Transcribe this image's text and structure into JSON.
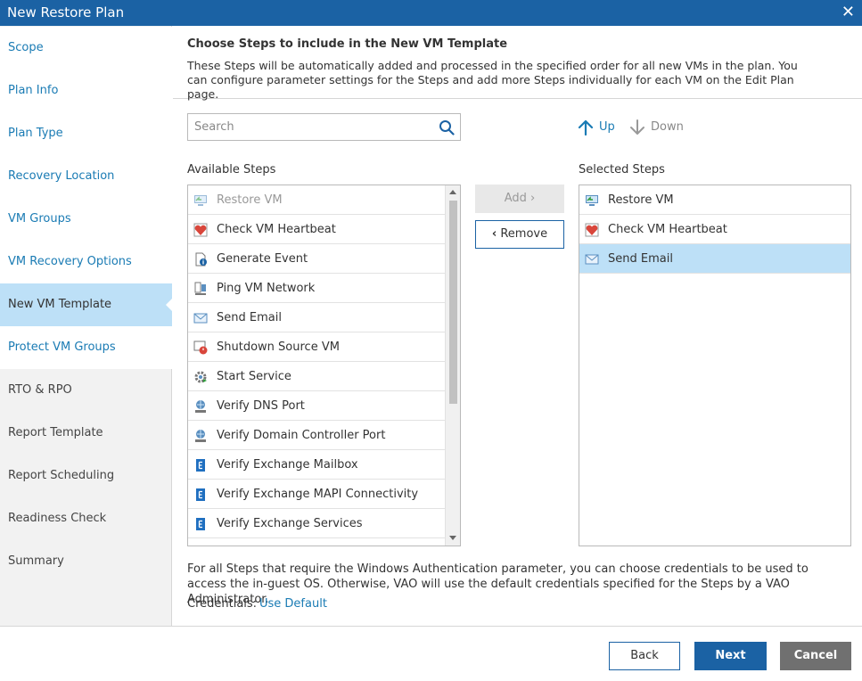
{
  "window": {
    "title": "New Restore Plan",
    "close_icon": "close-icon"
  },
  "sidebar": {
    "items": [
      {
        "label": "Scope",
        "state": "done"
      },
      {
        "label": "Plan Info",
        "state": "done"
      },
      {
        "label": "Plan Type",
        "state": "done"
      },
      {
        "label": "Recovery Location",
        "state": "done"
      },
      {
        "label": "VM Groups",
        "state": "done"
      },
      {
        "label": "VM Recovery Options",
        "state": "done"
      },
      {
        "label": "New VM Template",
        "state": "active"
      },
      {
        "label": "Protect VM Groups",
        "state": "done"
      },
      {
        "label": "RTO & RPO",
        "state": "future"
      },
      {
        "label": "Report Template",
        "state": "future"
      },
      {
        "label": "Report Scheduling",
        "state": "future"
      },
      {
        "label": "Readiness Check",
        "state": "future"
      },
      {
        "label": "Summary",
        "state": "future"
      }
    ]
  },
  "main": {
    "heading": "Choose Steps to include in the New VM Template",
    "description": "These Steps will be automatically added and processed in the specified order for all new VMs in the plan. You can configure parameter settings for the Steps and add more Steps individually for each VM on the Edit Plan page.",
    "search": {
      "placeholder": "Search",
      "value": ""
    },
    "up_label": "Up",
    "down_label": "Down",
    "available_label": "Available Steps",
    "selected_label": "Selected Steps",
    "add_label": "Add",
    "remove_label": "Remove",
    "available_steps": [
      {
        "label": "Restore VM",
        "icon": "restore-vm-icon",
        "disabled": true
      },
      {
        "label": "Check VM Heartbeat",
        "icon": "heartbeat-icon"
      },
      {
        "label": "Generate Event",
        "icon": "event-icon"
      },
      {
        "label": "Ping VM Network",
        "icon": "ping-icon"
      },
      {
        "label": "Send Email",
        "icon": "email-icon"
      },
      {
        "label": "Shutdown Source VM",
        "icon": "shutdown-icon"
      },
      {
        "label": "Start Service",
        "icon": "service-icon"
      },
      {
        "label": "Verify DNS Port",
        "icon": "dns-icon"
      },
      {
        "label": "Verify Domain Controller Port",
        "icon": "dc-port-icon"
      },
      {
        "label": "Verify Exchange Mailbox",
        "icon": "exchange-icon"
      },
      {
        "label": "Verify Exchange MAPI Connectivity",
        "icon": "exchange-icon"
      },
      {
        "label": "Verify Exchange Services",
        "icon": "exchange-icon"
      }
    ],
    "selected_steps": [
      {
        "label": "Restore VM",
        "icon": "restore-vm-icon"
      },
      {
        "label": "Check VM Heartbeat",
        "icon": "heartbeat-icon"
      },
      {
        "label": "Send Email",
        "icon": "email-icon",
        "selected": true
      }
    ],
    "note": "For all Steps that require the Windows Authentication parameter, you can choose credentials to be used to access the in-guest OS. Otherwise, VAO will use the default credentials specified for the Steps by a VAO Administrator.",
    "credentials_label": "Credentials:",
    "credentials_link": "Use Default"
  },
  "footer": {
    "back_label": "Back",
    "next_label": "Next",
    "cancel_label": "Cancel"
  },
  "colors": {
    "title_bar": "#1b62a4",
    "link": "#1a7bb4",
    "selection": "#bde0f7",
    "cancel": "#707070"
  }
}
